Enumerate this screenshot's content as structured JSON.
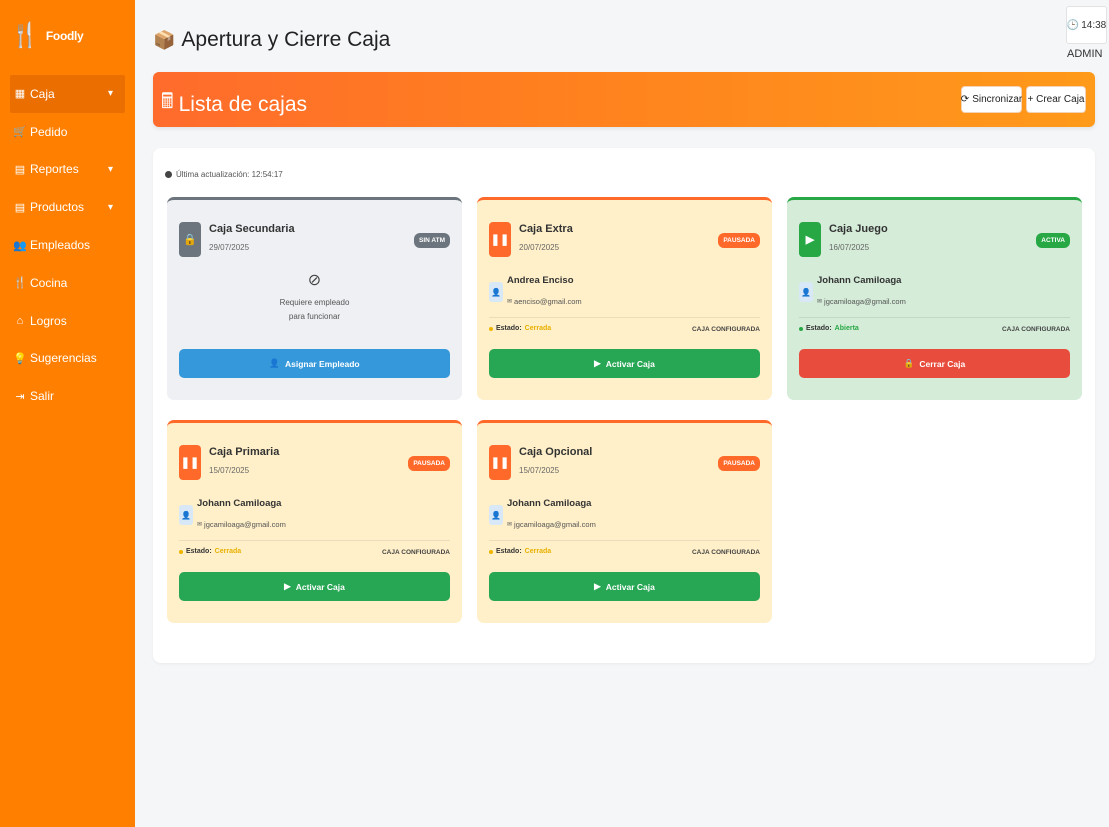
{
  "app": {
    "brand": "Foodly"
  },
  "sidebar": {
    "items": [
      {
        "label": "Caja",
        "icon": "grid-icon",
        "has_chevron": true,
        "active": true
      },
      {
        "label": "Pedido",
        "icon": "cart-icon",
        "has_chevron": false
      },
      {
        "label": "Reportes",
        "icon": "file-icon",
        "has_chevron": true
      },
      {
        "label": "Productos",
        "icon": "file-icon",
        "has_chevron": true
      },
      {
        "label": "Empleados",
        "icon": "users-icon",
        "has_chevron": false
      },
      {
        "label": "Cocina",
        "icon": "utensils-icon",
        "has_chevron": false
      },
      {
        "label": "Logros",
        "icon": "home-icon",
        "has_chevron": false
      },
      {
        "label": "Sugerencias",
        "icon": "lightbulb-icon",
        "has_chevron": false
      },
      {
        "label": "Salir",
        "icon": "logout-icon",
        "has_chevron": false
      }
    ]
  },
  "header": {
    "title": "Apertura y Cierre Caja",
    "time": "14:38",
    "role": "ADMIN"
  },
  "banner": {
    "title": "Lista de cajas",
    "sync_label": "Sincronizar",
    "create_label": "+ Crear Caja"
  },
  "panel": {
    "last_update": "Última actualización: 12:54:17"
  },
  "cards": [
    {
      "name": "Caja Secundaria",
      "date": "29/07/2025",
      "badge": "SIN ATM",
      "theme": "gray",
      "empty_line1": "Requiere empleado",
      "empty_line2": "para funcionar",
      "button": "Asignar Empleado"
    },
    {
      "name": "Caja Extra",
      "date": "20/07/2025",
      "badge": "PAUSADA",
      "theme": "yellow",
      "employee": "Andrea Enciso",
      "email": "aenciso@gmail.com",
      "state_label": "Estado:",
      "state_value": "Cerrada",
      "config": "CAJA CONFIGURADA",
      "button": "Activar Caja"
    },
    {
      "name": "Caja Juego",
      "date": "16/07/2025",
      "badge": "ACTIVA",
      "theme": "green",
      "employee": "Johann Camiloaga",
      "email": "jgcamiloaga@gmail.com",
      "state_label": "Estado:",
      "state_value": "Abierta",
      "config": "CAJA CONFIGURADA",
      "button": "Cerrar Caja"
    },
    {
      "name": "Caja Primaria",
      "date": "15/07/2025",
      "badge": "PAUSADA",
      "theme": "yellow",
      "employee": "Johann Camiloaga",
      "email": "jgcamiloaga@gmail.com",
      "state_label": "Estado:",
      "state_value": "Cerrada",
      "config": "CAJA CONFIGURADA",
      "button": "Activar Caja"
    },
    {
      "name": "Caja Opcional",
      "date": "15/07/2025",
      "badge": "PAUSADA",
      "theme": "yellow",
      "employee": "Johann Camiloaga",
      "email": "jgcamiloaga@gmail.com",
      "state_label": "Estado:",
      "state_value": "Cerrada",
      "config": "CAJA CONFIGURADA",
      "button": "Activar Caja"
    }
  ]
}
